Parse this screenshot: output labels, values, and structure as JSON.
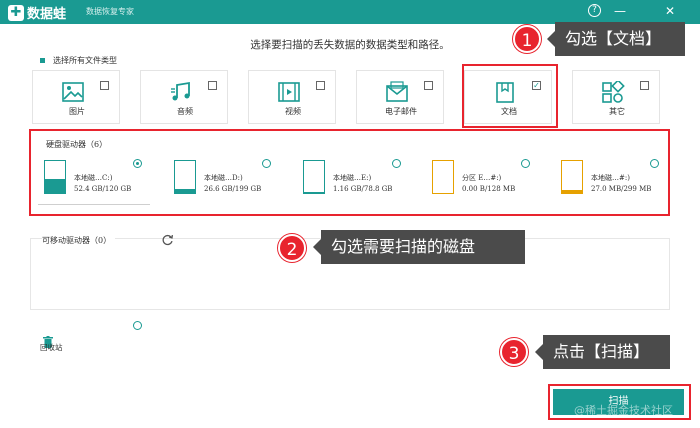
{
  "app": {
    "name": "数据蛙",
    "subtitle": "数据恢复专家"
  },
  "window": {
    "help": "?",
    "minimize": "—",
    "close": "✕"
  },
  "instruction": "选择要扫描的丢失数据的数据类型和路径。",
  "select_all_label": "选择所有文件类型",
  "file_types": [
    {
      "label": "图片",
      "icon": "image-icon",
      "checked": false
    },
    {
      "label": "音频",
      "icon": "music-icon",
      "checked": false
    },
    {
      "label": "视频",
      "icon": "video-icon",
      "checked": false
    },
    {
      "label": "电子邮件",
      "icon": "email-icon",
      "checked": false
    },
    {
      "label": "文档",
      "icon": "document-icon",
      "checked": true
    },
    {
      "label": "其它",
      "icon": "other-icon",
      "checked": false
    }
  ],
  "drives_header": "硬盘驱动器（6）",
  "drives": [
    {
      "name": "本地磁…C:)",
      "size": "52.4 GB/120 GB",
      "used": 0.44,
      "selected": true
    },
    {
      "name": "本地磁…D:)",
      "size": "26.6 GB/199 GB",
      "used": 0.13,
      "selected": false
    },
    {
      "name": "本地磁…E:)",
      "size": "1.16 GB/78.8 GB",
      "used": 0.01,
      "selected": false
    },
    {
      "name": "分区 E…#:)",
      "size": "0.00  B/128 MB",
      "used": 0.0,
      "selected": false
    },
    {
      "name": "本地磁…#:)",
      "size": "27.0 MB/299 MB",
      "used": 0.09,
      "selected": false
    }
  ],
  "removable_header": "可移动驱动器（0）",
  "recycle_label": "回收站",
  "scan_button": "扫描",
  "callouts": [
    {
      "num": "1",
      "text": "勾选【文档】"
    },
    {
      "num": "2",
      "text": "勾选需要扫描的磁盘"
    },
    {
      "num": "3",
      "text": "点击【扫描】"
    }
  ],
  "watermark": "@稀土掘金技术社区",
  "colors": {
    "accent": "#1a9a92",
    "highlight": "#e8242e",
    "callout_bg": "#4b4b4b",
    "drive_warning": "#e6a100"
  }
}
